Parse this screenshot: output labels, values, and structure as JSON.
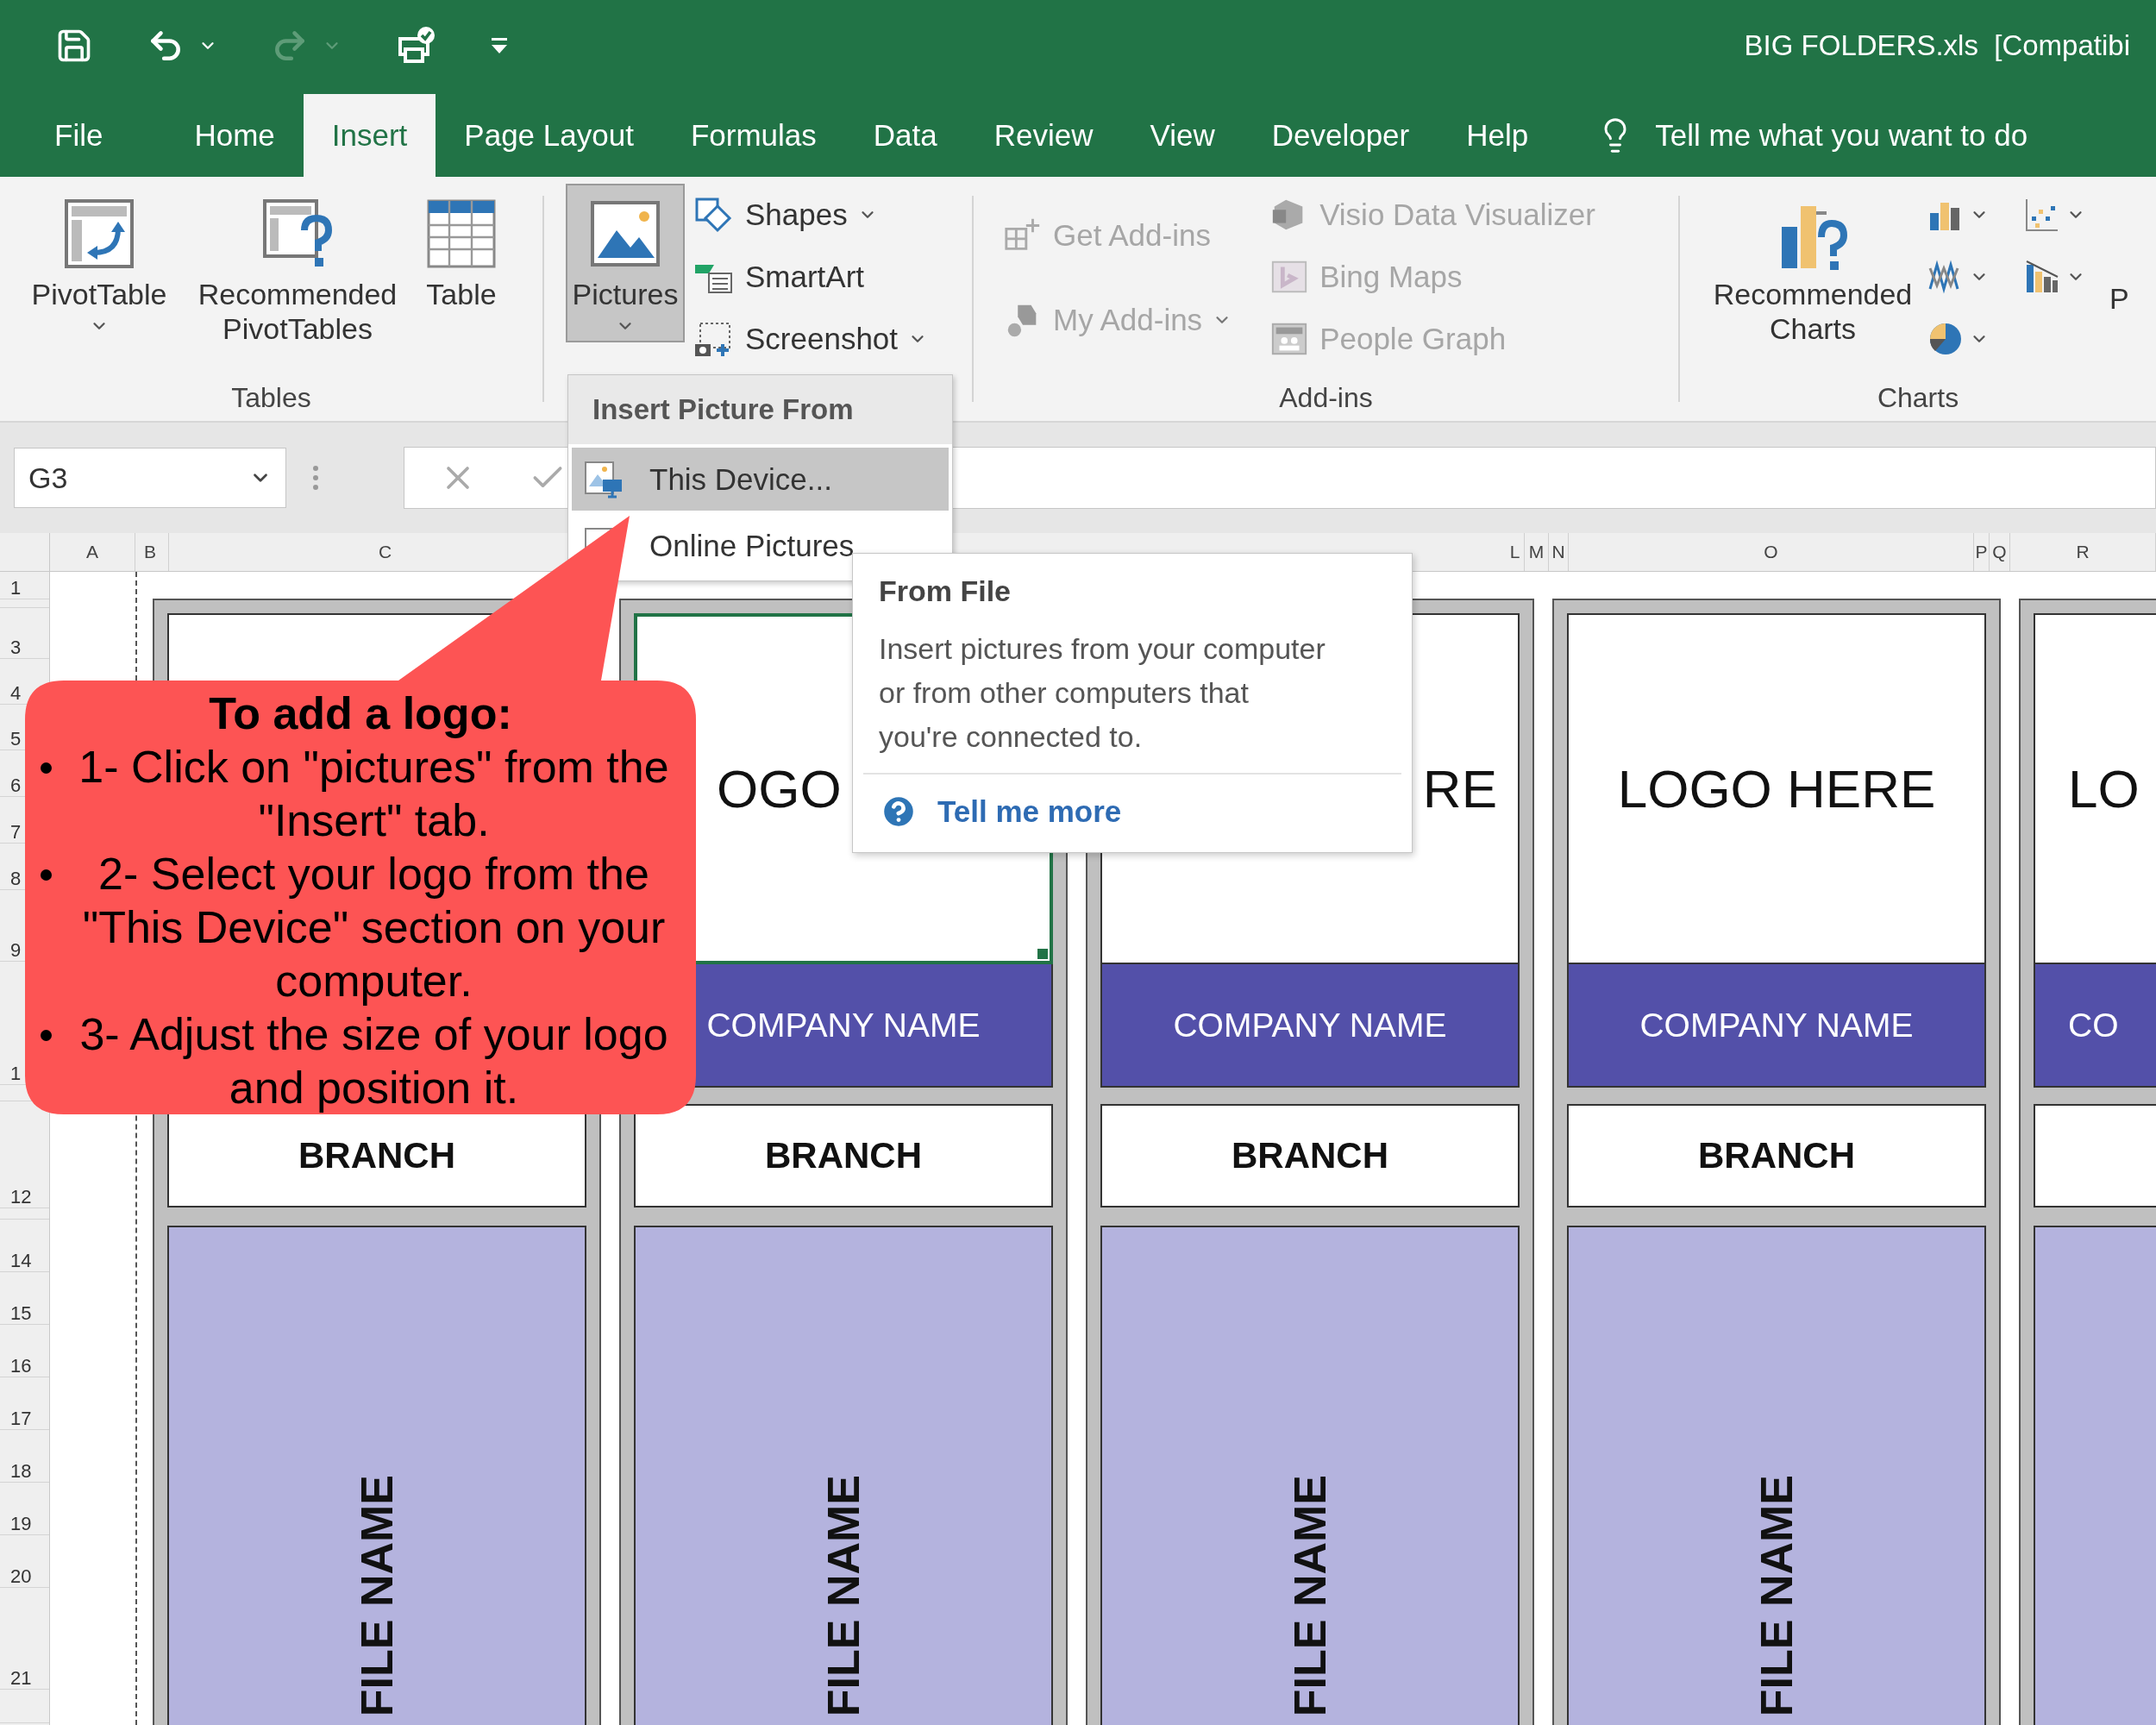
{
  "window": {
    "title": "BIG FOLDERS.xls  [Compatibi"
  },
  "tabs": [
    {
      "label": "File",
      "selected": false
    },
    {
      "label": "Home",
      "selected": false
    },
    {
      "label": "Insert",
      "selected": true
    },
    {
      "label": "Page Layout",
      "selected": false
    },
    {
      "label": "Formulas",
      "selected": false
    },
    {
      "label": "Data",
      "selected": false
    },
    {
      "label": "Review",
      "selected": false
    },
    {
      "label": "View",
      "selected": false
    },
    {
      "label": "Developer",
      "selected": false
    },
    {
      "label": "Help",
      "selected": false
    }
  ],
  "tell_me": "Tell me what you want to do",
  "ribbon": {
    "tables": {
      "label": "Tables",
      "buttons": [
        {
          "label": "PivotTable",
          "dropdown": true
        },
        {
          "label": "Recommended\nPivotTables",
          "dropdown": false
        },
        {
          "label": "Table",
          "dropdown": false
        }
      ]
    },
    "illustrations": {
      "buttons": [
        {
          "kind": "large",
          "label": "Pictures",
          "pressed": true,
          "dropdown": true
        },
        {
          "kind": "small",
          "label": "Shapes",
          "dropdown": true
        },
        {
          "kind": "small",
          "label": "SmartArt",
          "dropdown": false
        },
        {
          "kind": "small",
          "label": "Screenshot",
          "dropdown": true
        }
      ]
    },
    "addins": {
      "label": "Add-ins",
      "buttons": [
        {
          "label": "Get Add-ins",
          "disabled": true,
          "dropdown": false
        },
        {
          "label": "My Add-ins",
          "disabled": true,
          "dropdown": true
        }
      ],
      "apps": [
        {
          "label": "Visio Data Visualizer",
          "disabled": true
        },
        {
          "label": "Bing Maps",
          "disabled": true
        },
        {
          "label": "People Graph",
          "disabled": true
        }
      ]
    },
    "charts": {
      "label": "Charts",
      "recommended": "Recommended\nCharts",
      "more_label": "P"
    }
  },
  "formula_bar": {
    "name_box": "G3"
  },
  "picture_menu": {
    "header": "Insert Picture From",
    "items": [
      {
        "label": "This Device...",
        "selected": true
      },
      {
        "label": "Online Pictures",
        "selected": false
      }
    ]
  },
  "tooltip": {
    "title": "From File",
    "body": "Insert pictures from your computer\nor from other computers that\nyou're connected to.",
    "link": "Tell me more"
  },
  "callout": {
    "title": "To add a logo:",
    "steps": [
      "1- Click on \"pictures\" from the\n\"Insert\" tab.",
      "2- Select your logo from the\n\"This Device\" section on your\ncomputer.",
      "3- Adjust the size of your logo\nand position it."
    ]
  },
  "sheet": {
    "column_headers": [
      "A",
      "B",
      "C",
      "L",
      "M",
      "N",
      "O",
      "P",
      "Q",
      "R"
    ],
    "row_headers": [
      "1",
      "3",
      "4",
      "5",
      "6",
      "7",
      "8",
      "9",
      "1",
      "12",
      "14",
      "15",
      "16",
      "17",
      "18",
      "19",
      "20",
      "21"
    ],
    "folders": [
      {
        "branch": "BRANCH",
        "file_name": "FILE NAME",
        "selected": false
      },
      {
        "logo": "OGO",
        "company": "COMPANY NAME",
        "branch": "BRANCH",
        "file_name": "FILE NAME",
        "selected": true
      },
      {
        "logo": "RE",
        "company": "COMPANY NAME",
        "branch": "BRANCH",
        "file_name": "FILE NAME",
        "selected": false
      },
      {
        "logo": "LOGO HERE",
        "company": "COMPANY NAME",
        "branch": "BRANCH",
        "file_name": "FILE NAME",
        "selected": false
      },
      {
        "logo": "LO",
        "company": "CO",
        "selected": false
      }
    ]
  }
}
